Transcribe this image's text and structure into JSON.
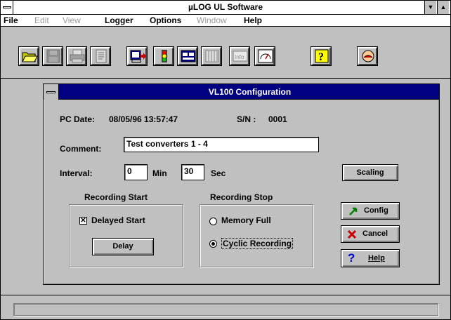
{
  "window": {
    "title": "µLOG UL Software"
  },
  "menu": [
    {
      "label": "File",
      "enabled": true
    },
    {
      "label": "Edit",
      "enabled": false
    },
    {
      "label": "View",
      "enabled": false
    },
    {
      "label": "Logger",
      "enabled": true
    },
    {
      "label": "Options",
      "enabled": true
    },
    {
      "label": "Window",
      "enabled": false
    },
    {
      "label": "Help",
      "enabled": true
    }
  ],
  "toolbar": {
    "icons": [
      "open-folder-icon",
      "save-disk-icon",
      "print-icon",
      "document-icon",
      "download-logger-icon",
      "traffic-light-icon",
      "display-panel-icon",
      "bar-graph-icon",
      "info-icon",
      "gauge-icon",
      "help-icon",
      "exit-icon"
    ],
    "info_label": "Info"
  },
  "dialog": {
    "title": "VL100  Configuration",
    "pc_date_label": "PC Date:",
    "pc_date_value": "08/05/96  13:57:47",
    "sn_label": "S/N  :",
    "sn_value": "0001",
    "comment_label": "Comment:",
    "comment_value": "Test converters 1 - 4",
    "interval_label": "Interval:",
    "interval_min_value": "0",
    "min_label": "Min",
    "interval_sec_value": "30",
    "sec_label": "Sec",
    "scaling_label": "Scaling",
    "recording_start": {
      "title": "Recording Start",
      "delayed_start_label": "Delayed Start",
      "delayed_start_checked": true,
      "delay_button": "Delay"
    },
    "recording_stop": {
      "title": "Recording Stop",
      "memory_full_label": "Memory Full",
      "cyclic_label": "Cyclic Recording",
      "selected": "Cyclic Recording"
    },
    "config_label": "Config",
    "cancel_label": "Cancel",
    "help_label": "Help"
  },
  "colors": {
    "titlebar_active": "#000080",
    "face": "#c0c0c0",
    "cancel_x": "#cc0000",
    "help_q": "#0000cc",
    "config_arrow": "#008000"
  }
}
